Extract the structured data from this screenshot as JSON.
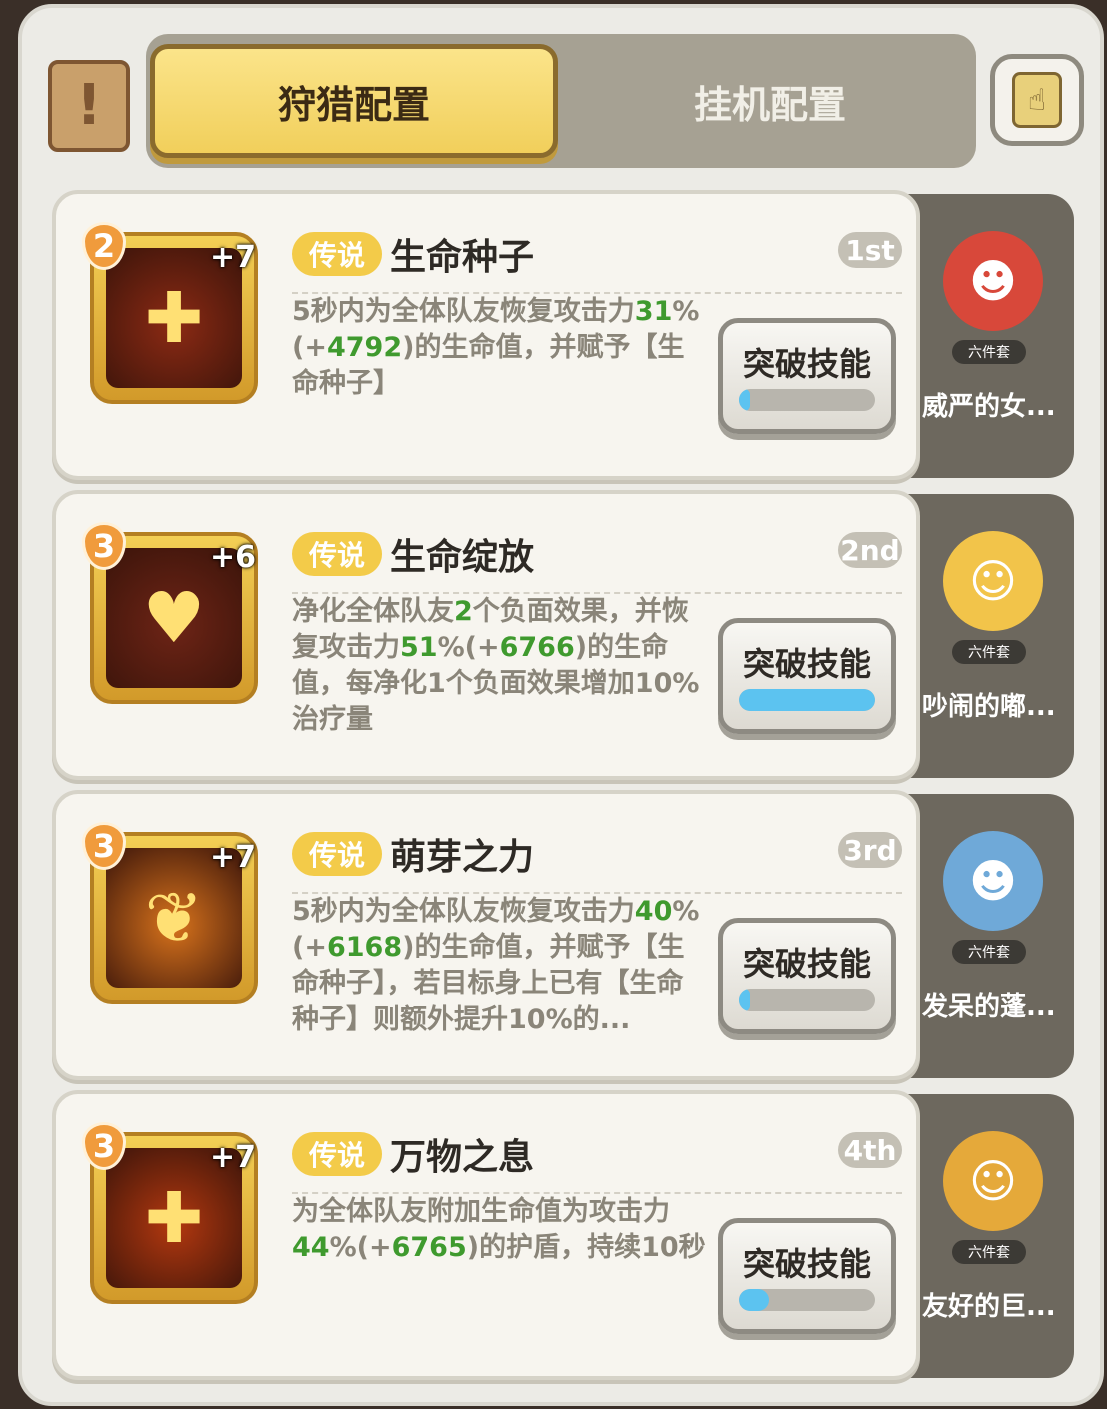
{
  "header": {
    "tabs": [
      {
        "label": "狩猎配置",
        "active": true
      },
      {
        "label": "挂机配置",
        "active": false
      }
    ]
  },
  "skills": [
    {
      "level": "2",
      "plus": "+7",
      "rarity": "传说",
      "name": "生命种子",
      "rank": "1st",
      "desc": [
        {
          "t": "5秒内为全体队友恢复攻击力"
        },
        {
          "t": "31",
          "g": true
        },
        {
          "t": "%(+"
        },
        {
          "t": "4792",
          "g": true
        },
        {
          "t": ")的生命值，并赋予【生命种子】"
        }
      ],
      "button": "突破技能",
      "progress": 0.05,
      "pet_name": "威严的女...",
      "set_label": "六件套",
      "pet_color": "#d8483a",
      "icon_color": "#8c2a14",
      "icon": "seed-icon"
    },
    {
      "level": "3",
      "plus": "+6",
      "rarity": "传说",
      "name": "生命绽放",
      "rank": "2nd",
      "desc": [
        {
          "t": "净化全体队友"
        },
        {
          "t": "2",
          "g": true
        },
        {
          "t": "个负面效果，并恢复攻击力"
        },
        {
          "t": "51",
          "g": true
        },
        {
          "t": "%(+"
        },
        {
          "t": "6766",
          "g": true
        },
        {
          "t": ")的生命值，每净化1个负面效果增加10%治疗量"
        }
      ],
      "button": "突破技能",
      "progress": 1.0,
      "pet_name": "吵闹的嘟...",
      "set_label": "六件套",
      "pet_color": "#f2c44a",
      "icon_color": "#6e2416",
      "icon": "heart-flower-icon"
    },
    {
      "level": "3",
      "plus": "+7",
      "rarity": "传说",
      "name": "萌芽之力",
      "rank": "3rd",
      "desc": [
        {
          "t": "5秒内为全体队友恢复攻击力"
        },
        {
          "t": "40",
          "g": true
        },
        {
          "t": "%(+"
        },
        {
          "t": "6168",
          "g": true
        },
        {
          "t": ")的生命值，并赋予【生命种子】，若目标身上已有【生命种子】则额外提升10%的..."
        }
      ],
      "button": "突破技能",
      "progress": 0.03,
      "pet_name": "发呆的蓬...",
      "set_label": "六件套",
      "pet_color": "#6fa9d8",
      "icon_color": "#d8731c",
      "icon": "sprout-icon"
    },
    {
      "level": "3",
      "plus": "+7",
      "rarity": "传说",
      "name": "万物之息",
      "rank": "4th",
      "desc": [
        {
          "t": "为全体队友附加生命值为攻击力"
        },
        {
          "t": "44",
          "g": true
        },
        {
          "t": "%(+"
        },
        {
          "t": "6765",
          "g": true
        },
        {
          "t": ")的护盾，持续10秒"
        }
      ],
      "button": "突破技能",
      "progress": 0.22,
      "pet_name": "友好的巨...",
      "set_label": "六件套",
      "pet_color": "#e5a93a",
      "icon_color": "#b3380f",
      "icon": "crosses-icon"
    }
  ]
}
